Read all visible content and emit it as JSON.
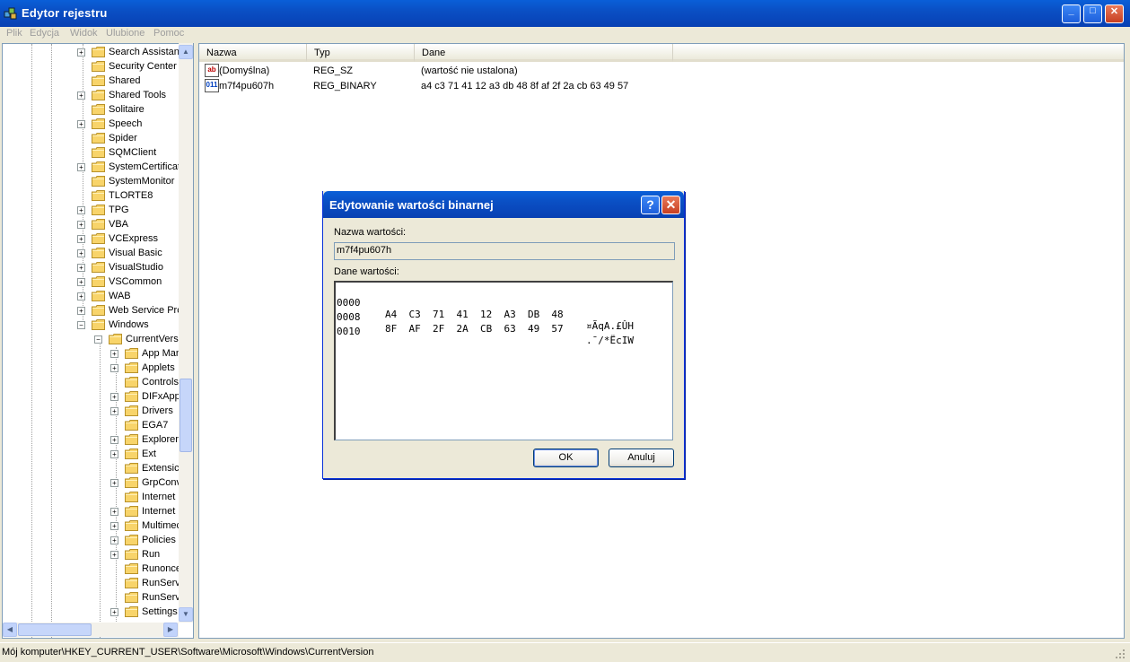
{
  "window": {
    "title": "Edytor rejestru",
    "min_label": "_",
    "max_label": "□",
    "close_label": "✕"
  },
  "menu": [
    "Plik",
    "Edycja",
    "Widok",
    "Ulubione",
    "Pomoc"
  ],
  "tree": {
    "items": [
      {
        "label": "Search Assistan",
        "expander": "+",
        "level": 0
      },
      {
        "label": "Security Center",
        "expander": "",
        "level": 0
      },
      {
        "label": "Shared",
        "expander": "",
        "level": 0
      },
      {
        "label": "Shared Tools",
        "expander": "+",
        "level": 0
      },
      {
        "label": "Solitaire",
        "expander": "",
        "level": 0
      },
      {
        "label": "Speech",
        "expander": "+",
        "level": 0
      },
      {
        "label": "Spider",
        "expander": "",
        "level": 0
      },
      {
        "label": "SQMClient",
        "expander": "",
        "level": 0
      },
      {
        "label": "SystemCertificat",
        "expander": "+",
        "level": 0
      },
      {
        "label": "SystemMonitor",
        "expander": "",
        "level": 0
      },
      {
        "label": "TLORTE8",
        "expander": "",
        "level": 0
      },
      {
        "label": "TPG",
        "expander": "+",
        "level": 0
      },
      {
        "label": "VBA",
        "expander": "+",
        "level": 0
      },
      {
        "label": "VCExpress",
        "expander": "+",
        "level": 0
      },
      {
        "label": "Visual Basic",
        "expander": "+",
        "level": 0
      },
      {
        "label": "VisualStudio",
        "expander": "+",
        "level": 0
      },
      {
        "label": "VSCommon",
        "expander": "+",
        "level": 0
      },
      {
        "label": "WAB",
        "expander": "+",
        "level": 0
      },
      {
        "label": "Web Service Pro",
        "expander": "+",
        "level": 0
      },
      {
        "label": "Windows",
        "expander": "−",
        "level": 0
      },
      {
        "label": "CurrentVers",
        "expander": "−",
        "level": 1
      },
      {
        "label": "App Man",
        "expander": "+",
        "level": 2
      },
      {
        "label": "Applets",
        "expander": "+",
        "level": 2
      },
      {
        "label": "Controls",
        "expander": "",
        "level": 2
      },
      {
        "label": "DIFxApp",
        "expander": "+",
        "level": 2
      },
      {
        "label": "Drivers",
        "expander": "+",
        "level": 2
      },
      {
        "label": "EGA7",
        "expander": "",
        "level": 2
      },
      {
        "label": "Explorer",
        "expander": "+",
        "level": 2
      },
      {
        "label": "Ext",
        "expander": "+",
        "level": 2
      },
      {
        "label": "Extensic",
        "expander": "",
        "level": 2
      },
      {
        "label": "GrpConv",
        "expander": "+",
        "level": 2
      },
      {
        "label": "Internet",
        "expander": "",
        "level": 2
      },
      {
        "label": "Internet",
        "expander": "+",
        "level": 2
      },
      {
        "label": "Multimec",
        "expander": "+",
        "level": 2
      },
      {
        "label": "Policies",
        "expander": "+",
        "level": 2
      },
      {
        "label": "Run",
        "expander": "+",
        "level": 2
      },
      {
        "label": "Runonce",
        "expander": "",
        "level": 2
      },
      {
        "label": "RunServ",
        "expander": "",
        "level": 2
      },
      {
        "label": "RunServ",
        "expander": "",
        "level": 2
      },
      {
        "label": "Settings",
        "expander": "+",
        "level": 2
      }
    ]
  },
  "list": {
    "columns": [
      "Nazwa",
      "Typ",
      "Dane"
    ],
    "rows": [
      {
        "icon": "ab",
        "name": "(Domyślna)",
        "type": "REG_SZ",
        "data": "(wartość nie ustalona)"
      },
      {
        "icon": "011",
        "name": "m7f4pu607h",
        "type": "REG_BINARY",
        "data": "a4 c3 71 41 12 a3 db 48 8f af 2f 2a cb 63 49 57"
      }
    ]
  },
  "status": "Mój komputer\\HKEY_CURRENT_USER\\Software\\Microsoft\\Windows\\CurrentVersion",
  "dialog": {
    "title": "Edytowanie wartości binarnej",
    "help_label": "?",
    "close_label": "✕",
    "name_label": "Nazwa wartości:",
    "name_value": "m7f4pu607h",
    "data_label": "Dane wartości:",
    "hex_lines": [
      {
        "offset": "0000",
        "bytes": "A4  C3  71  41  12  A3  DB  48",
        "ascii": "¤ÃqA.£ÛH"
      },
      {
        "offset": "0008",
        "bytes": "8F  AF  2F  2A  CB  63  49  57",
        "ascii": ".¯/*ËcIW"
      },
      {
        "offset": "0010",
        "bytes": "",
        "ascii": ""
      }
    ],
    "ok_label": "OK",
    "cancel_label": "Anuluj"
  }
}
